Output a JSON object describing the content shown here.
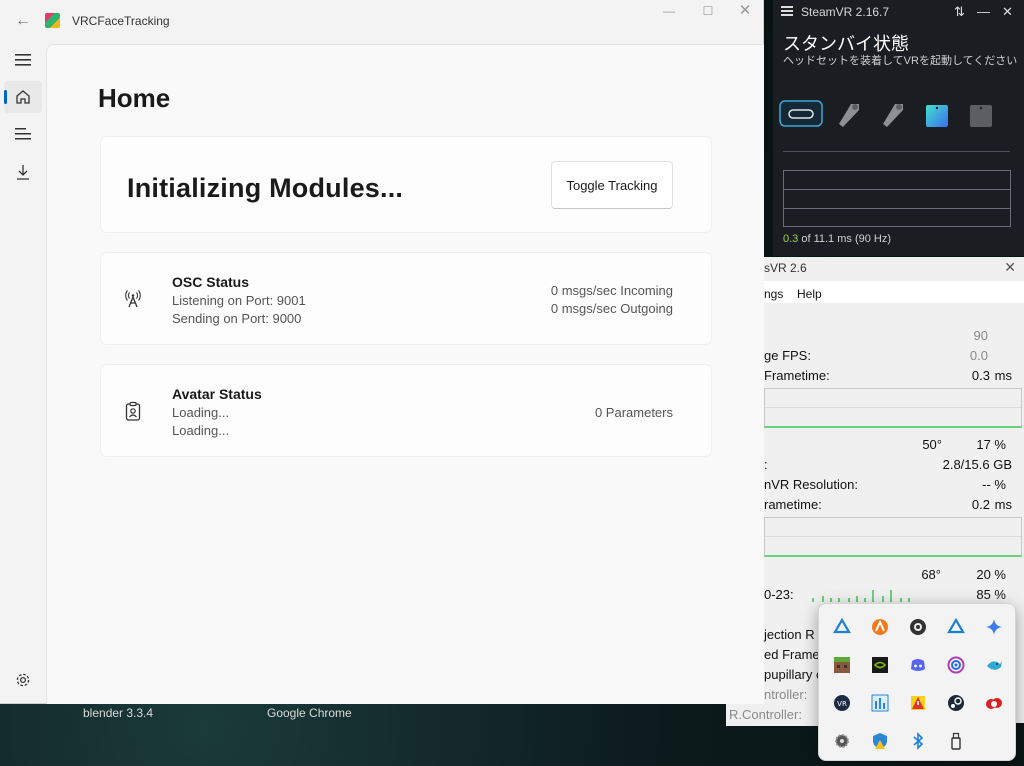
{
  "desktop": {
    "taskbar_labels": [
      "blender 3.3.4",
      "Google Chrome"
    ]
  },
  "vrcft": {
    "title": "VRCFaceTracking",
    "nav_icons": [
      "hamburger-menu-icon",
      "home-icon",
      "output-log-icon",
      "download-icon",
      "settings-icon"
    ],
    "page_title": "Home",
    "main_status": "Initializing Modules...",
    "toggle_button": "Toggle Tracking",
    "osc": {
      "title": "OSC Status",
      "listening": "Listening on Port: 9001",
      "sending": "Sending on Port: 9000",
      "incoming": "0 msgs/sec Incoming",
      "outgoing": "0 msgs/sec Outgoing"
    },
    "avatar": {
      "title": "Avatar Status",
      "line1": "Loading...",
      "line2": "Loading...",
      "params": "0 Parameters"
    }
  },
  "steamvr": {
    "title": "SteamVR 2.16.7",
    "status": "スタンバイ状態",
    "subtitle": "ヘッドセットを装着してVRを起動してください",
    "frametime_value": "0.3",
    "frametime_rest": " of 11.1 ms (90 Hz)",
    "accent": "#9bd44b"
  },
  "adv": {
    "title": "sVR 2.6",
    "menu": [
      "ngs",
      "Help"
    ],
    "rows": [
      {
        "label": "",
        "v1": "",
        "v2": "90",
        "gray": true
      },
      {
        "label": "ge FPS:",
        "v1": "",
        "v2": "0.0",
        "gray": true
      },
      {
        "label": "Frametime:",
        "v1": "0.3",
        "v2": "ms",
        "gray": false
      },
      {
        "label": "",
        "v1": "50°",
        "v2": "17 %",
        "gray": false
      },
      {
        "label": ":",
        "v1": "",
        "v2": "2.8/15.6 GB",
        "gray": false
      },
      {
        "label": "nVR Resolution:",
        "v1": "",
        "v2": "-- %",
        "gray": false
      },
      {
        "label": "rametime:",
        "v1": "0.2",
        "v2": "ms",
        "gray": false
      },
      {
        "label": "",
        "v1": "68°",
        "v2": "20 %",
        "gray": false
      },
      {
        "label": "0-23:",
        "v1": "",
        "v2": "85 %",
        "gray": false
      }
    ],
    "lower_rows": [
      "jection R",
      "ed Frame",
      "pupillary c",
      "ntroller:",
      "R.Controller:"
    ]
  },
  "tray": {
    "icons": [
      "vr-link-icon",
      "avast-icon",
      "webcam-icon",
      "vr-link-icon-2",
      "gemini-icon",
      "minecraft-icon",
      "nvidia-icon",
      "discord-icon",
      "podcast-icon",
      "fish-icon",
      "vive-icon",
      "audio-meter-icon",
      "warning-app-icon",
      "steam-icon",
      "creative-cloud-icon",
      "gear-app-icon",
      "shield-warning-icon",
      "bluetooth-icon",
      "usb-drive-icon"
    ]
  }
}
